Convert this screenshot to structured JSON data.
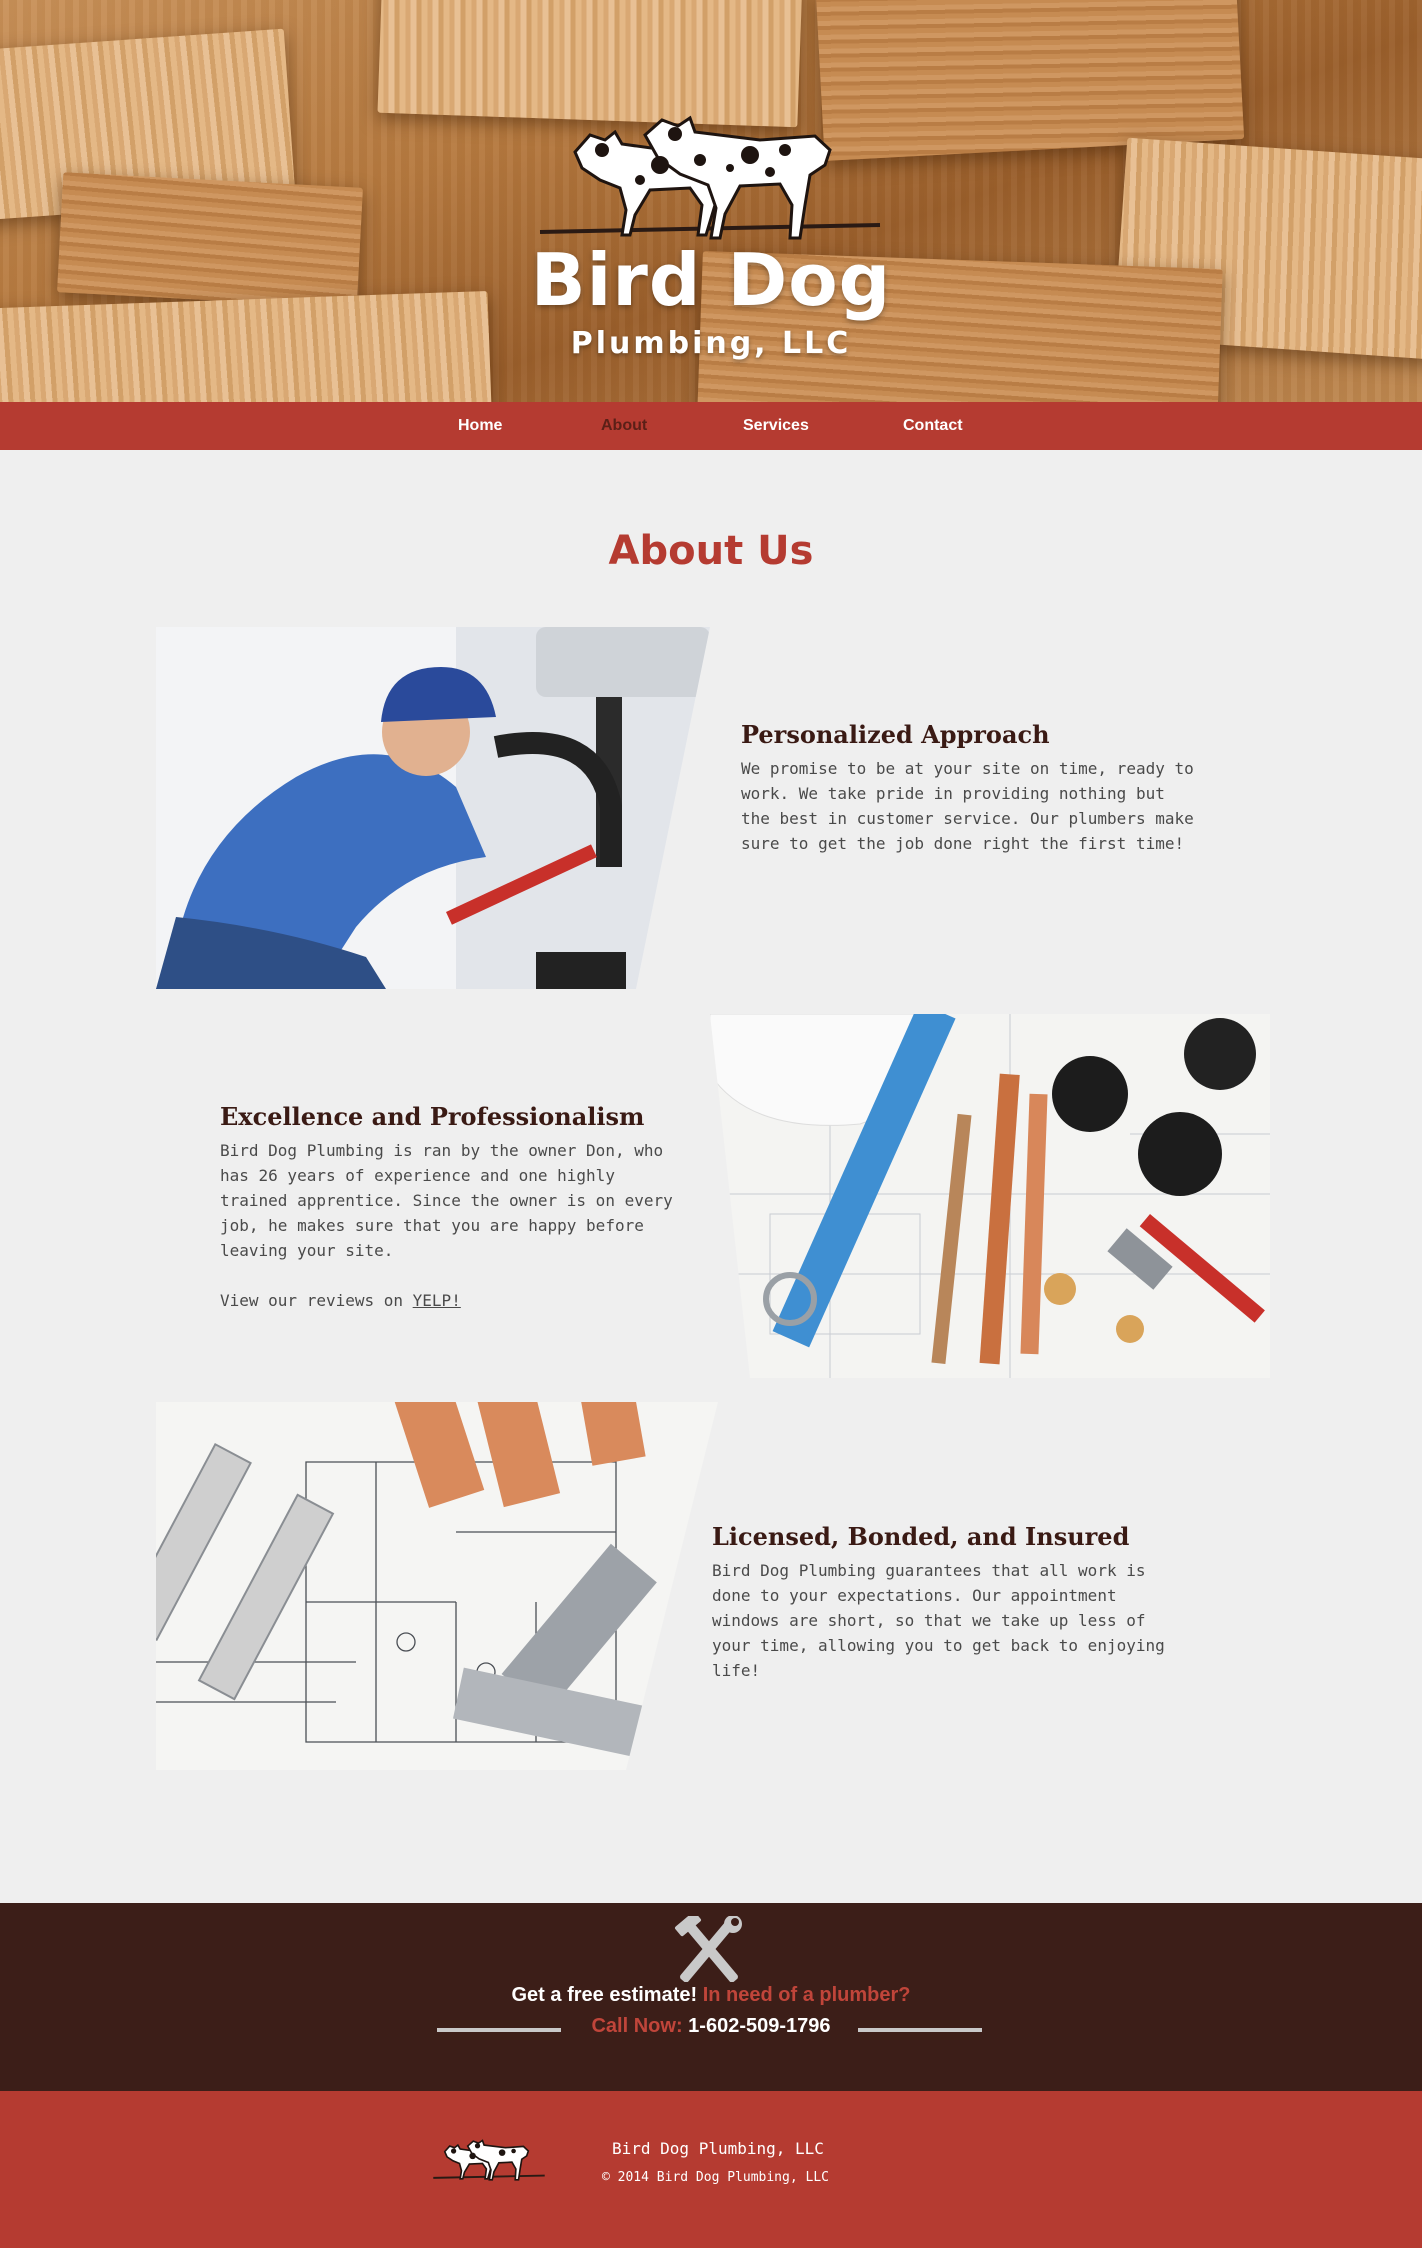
{
  "brand": {
    "title": "Bird Dog",
    "subtitle": "Plumbing, LLC"
  },
  "nav": [
    {
      "label": "Home"
    },
    {
      "label": "About"
    },
    {
      "label": "Services"
    },
    {
      "label": "Contact"
    }
  ],
  "nav_active": "About",
  "about": {
    "title": "About Us",
    "sections": [
      {
        "heading": "Personalized Approach",
        "body": "We promise to be at your site on time, ready to work. We take pride in providing nothing but the best in customer service. Our plumbers make sure to get the job done right the first time!",
        "image_icon": "plumber-under-sink-photo"
      },
      {
        "heading": "Excellence and Professionalism",
        "body": "Bird Dog Plumbing is ran by the owner Don, who has 26 years of experience and one highly trained apprentice. Since the owner is on every job, he makes sure that you are happy before leaving your site.",
        "reviews_prefix": "View our reviews on ",
        "reviews_link": "YELP!",
        "image_icon": "plumbing-tools-photo"
      },
      {
        "heading": "Licensed, Bonded, and Insured",
        "body": "Bird Dog Plumbing guarantees that all work is done to your expectations. Our appointment windows are short, so that we take up less of your time, allowing you to get back to enjoying life!",
        "image_icon": "pipes-blueprint-photo"
      }
    ]
  },
  "cta": {
    "icon": "tools-icon",
    "line1_white": "Get a free estimate!",
    "line1_red": "In need of a plumber?",
    "line2_red": "Call Now:",
    "phone": "1-602-509-1796"
  },
  "footer": {
    "name": "Bird Dog Plumbing, LLC",
    "copyright": "© 2014 Bird Dog Plumbing, LLC"
  },
  "colors": {
    "accent_red": "#b53b31",
    "dark_brown": "#3c1e18",
    "page_bg": "#efefef"
  }
}
